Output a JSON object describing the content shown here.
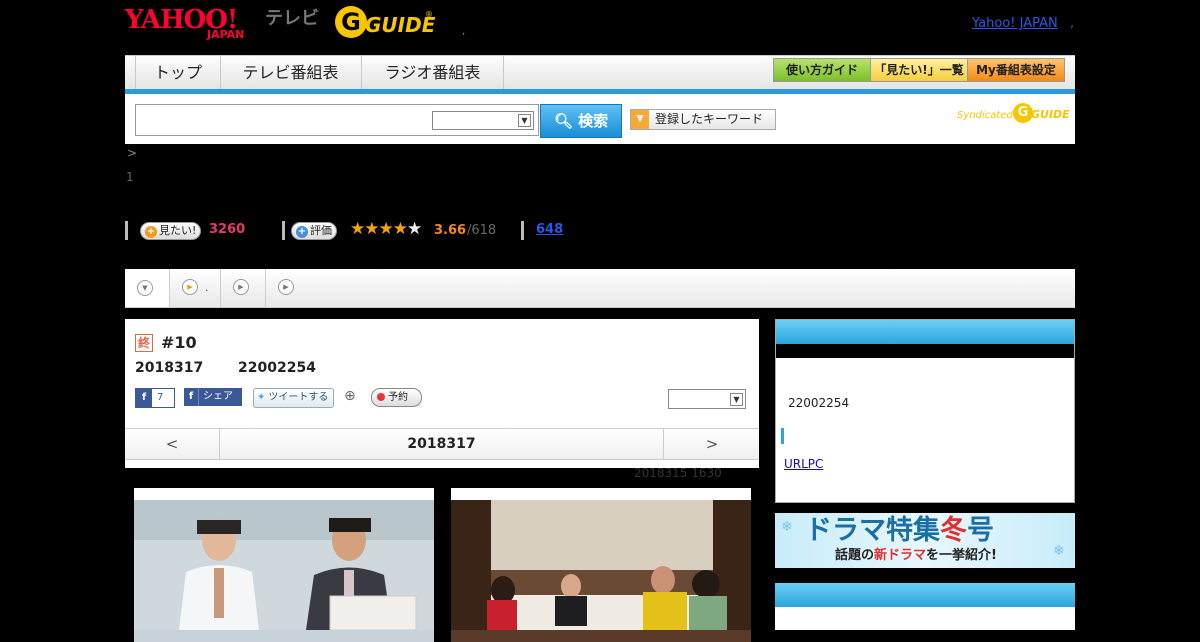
{
  "header": {
    "yahoo_logo": "YAHOO!",
    "yahoo_sub": "JAPAN",
    "tv_label": "テレビ",
    "gguide_logo": "GUIDE",
    "yahoo_japan_link": "Yahoo! JAPAN",
    "link_dot": ","
  },
  "nav": {
    "tabs": [
      "トップ",
      "テレビ番組表",
      "ラジオ番組表"
    ],
    "right_buttons": [
      "使い方ガイド",
      "「見たい!」一覧",
      "My番組表設定"
    ]
  },
  "search": {
    "input_value": "",
    "select_value": "",
    "button_label": "検索",
    "keyword_button": "登録したキーワード",
    "syndicated": "Syndicated"
  },
  "breadcrumb": ">",
  "program": {
    "count_line": "1",
    "mitai_label": "見たい!",
    "mitai_count": "3260",
    "rating_label": "評価",
    "rating_value": "3.66",
    "rating_count": "/618",
    "review_count": "648",
    "stars_on": "★★★★",
    "stars_off": "★"
  },
  "subtabs": [
    ".",
    "",
    "",
    ""
  ],
  "episode": {
    "end_mark": "終",
    "title": "#10",
    "date": "2018317",
    "time": "22002254",
    "fb_like_count": "7",
    "fb_share": "シェア",
    "tweet": "ツイートする",
    "reserve": "予約",
    "select_value": "",
    "pager_prev": "<",
    "pager_date": "2018317",
    "pager_next": ">",
    "updated": "2018315  1630"
  },
  "side": {
    "time": "22002254",
    "link": "URLPC",
    "banner_line1_a": "ドラマ特集",
    "banner_line1_b": "冬",
    "banner_line1_c": "号",
    "banner_line2_a": "話題の",
    "banner_line2_b": "新ドラマ",
    "banner_line2_c": "を一挙紹介!"
  }
}
